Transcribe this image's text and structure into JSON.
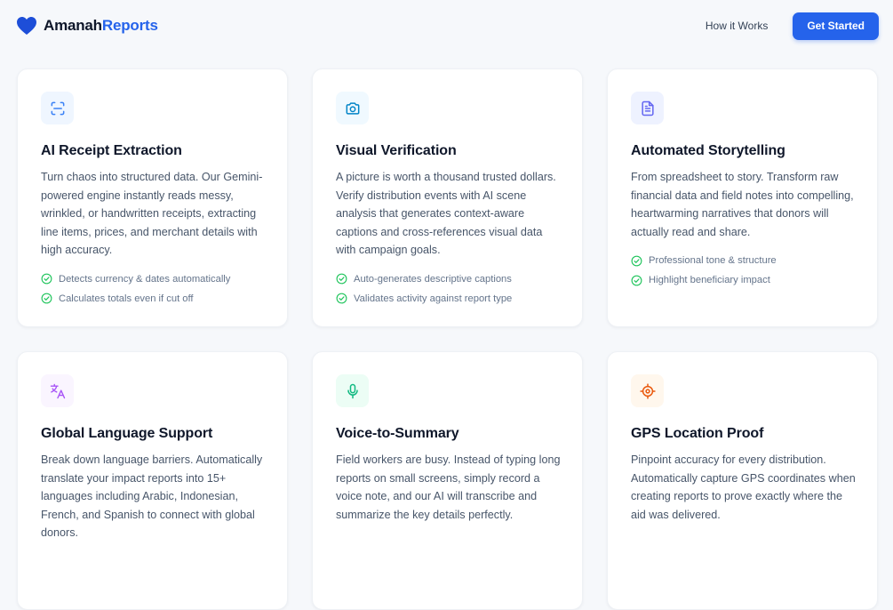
{
  "header": {
    "brand_primary": "Amanah",
    "brand_accent": "Reports",
    "brand_icon": "heart-icon",
    "nav_how": "How it Works",
    "cta": "Get Started",
    "accent_color": "#2563eb"
  },
  "cards": [
    {
      "icon": "scan-icon",
      "icon_color": "#3b82f6",
      "icon_bg": "#eff6ff",
      "title": "AI Receipt Extraction",
      "description": "Turn chaos into structured data. Our Gemini-powered engine instantly reads messy, wrinkled, or handwritten receipts, extracting line items, prices, and merchant details with high accuracy.",
      "features": [
        "Detects currency & dates automatically",
        "Calculates totals even if cut off"
      ]
    },
    {
      "icon": "camera-icon",
      "icon_color": "#0284c7",
      "icon_bg": "#f0f9ff",
      "title": "Visual Verification",
      "description": "A picture is worth a thousand trusted dollars. Verify distribution events with AI scene analysis that generates context-aware captions and cross-references visual data with campaign goals.",
      "features": [
        "Auto-generates descriptive captions",
        "Validates activity against report type"
      ]
    },
    {
      "icon": "document-icon",
      "icon_color": "#6366f1",
      "icon_bg": "#eef2ff",
      "title": "Automated Storytelling",
      "description": "From spreadsheet to story. Transform raw financial data and field notes into compelling, heartwarming narratives that donors will actually read and share.",
      "features": [
        "Professional tone & structure",
        "Highlight beneficiary impact"
      ]
    },
    {
      "icon": "translate-icon",
      "icon_color": "#a855f7",
      "icon_bg": "#faf5ff",
      "title": "Global Language Support",
      "description": "Break down language barriers. Automatically translate your impact reports into 15+ languages including Arabic, Indonesian, French, and Spanish to connect with global donors.",
      "features": []
    },
    {
      "icon": "microphone-icon",
      "icon_color": "#10b981",
      "icon_bg": "#ecfdf5",
      "title": "Voice-to-Summary",
      "description": "Field workers are busy. Instead of typing long reports on small screens, simply record a voice note, and our AI will transcribe and summarize the key details perfectly.",
      "features": []
    },
    {
      "icon": "crosshair-icon",
      "icon_color": "#ea580c",
      "icon_bg": "#fff7ed",
      "title": "GPS Location Proof",
      "description": "Pinpoint accuracy for every distribution. Automatically capture GPS coordinates when creating reports to prove exactly where the aid was delivered.",
      "features": []
    }
  ],
  "check_icon": "check-circle-icon",
  "check_color": "#22c55e"
}
